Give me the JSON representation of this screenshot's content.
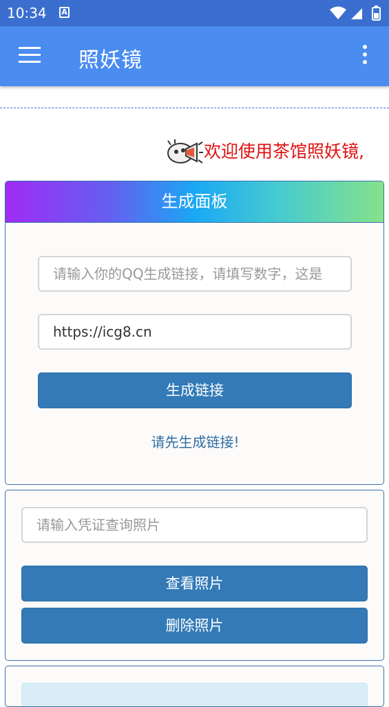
{
  "status_bar": {
    "time": "10:34",
    "notification_icon": "A",
    "icons": [
      "wifi-icon",
      "cellular-icon",
      "battery-icon"
    ]
  },
  "app_bar": {
    "title": "照妖镜",
    "menu_icon": "hamburger-menu-icon",
    "more_icon": "more-vertical-icon",
    "color": "#4a8cf0"
  },
  "marquee": {
    "icon": "megaphone-icon",
    "text": "欢迎使用茶馆照妖镜,"
  },
  "generate_panel": {
    "title": "生成面板",
    "qq_input": {
      "value": "",
      "placeholder": "请输入你的QQ生成链接，请填写数字，这是"
    },
    "url_input": {
      "value": "https://icg8.cn",
      "placeholder": ""
    },
    "generate_button": "生成链接",
    "hint": "请先生成链接!"
  },
  "query_panel": {
    "voucher_input": {
      "value": "",
      "placeholder": "请输入凭证查询照片"
    },
    "view_button": "查看照片",
    "delete_button": "删除照片"
  },
  "colors": {
    "status_bar": "#3a6fd0",
    "app_bar": "#4a8cf0",
    "button": "#337ab7",
    "marquee_text": "#e01010",
    "hint_text": "#2e6da4"
  }
}
